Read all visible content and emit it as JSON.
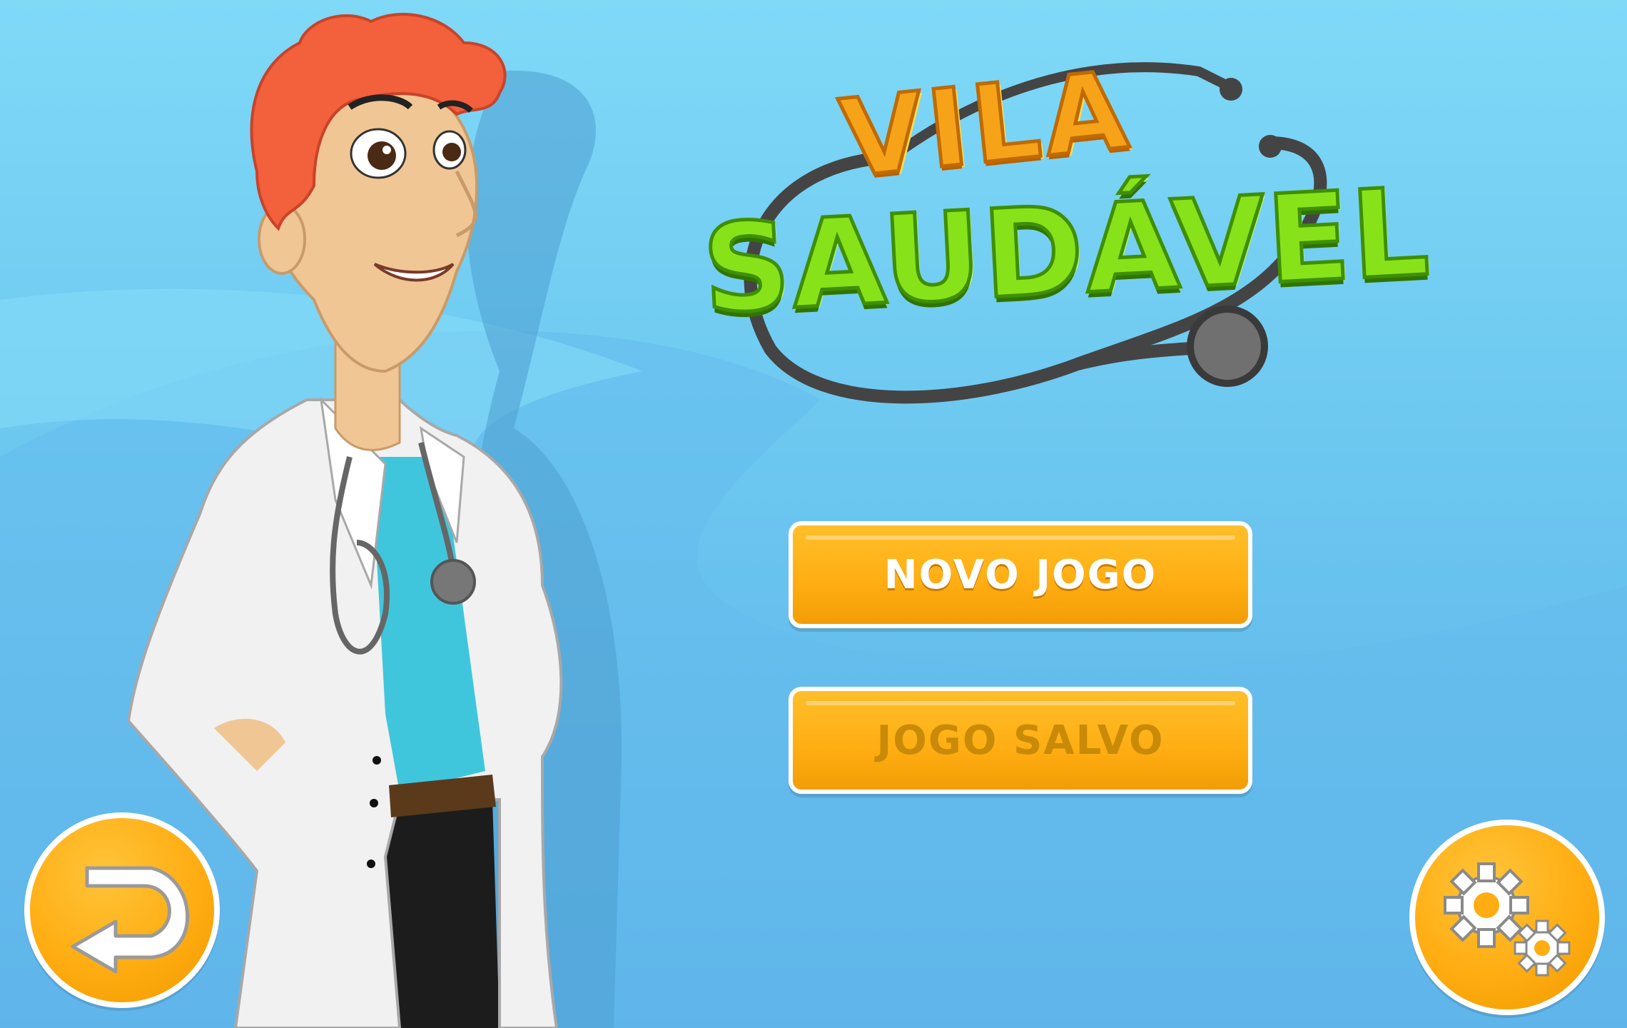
{
  "title": {
    "line1": "VILA",
    "line2": "SAUDÁVEL"
  },
  "menu": {
    "new_game_label": "NOVO JOGO",
    "saved_game_label": "JOGO SALVO"
  },
  "icons": {
    "back": "back-arrow-icon",
    "settings": "gears-icon"
  },
  "colors": {
    "background": "#6cc7f0",
    "button": "#ffad12",
    "title_orange": "#f6a31a",
    "title_green": "#88e21a"
  }
}
